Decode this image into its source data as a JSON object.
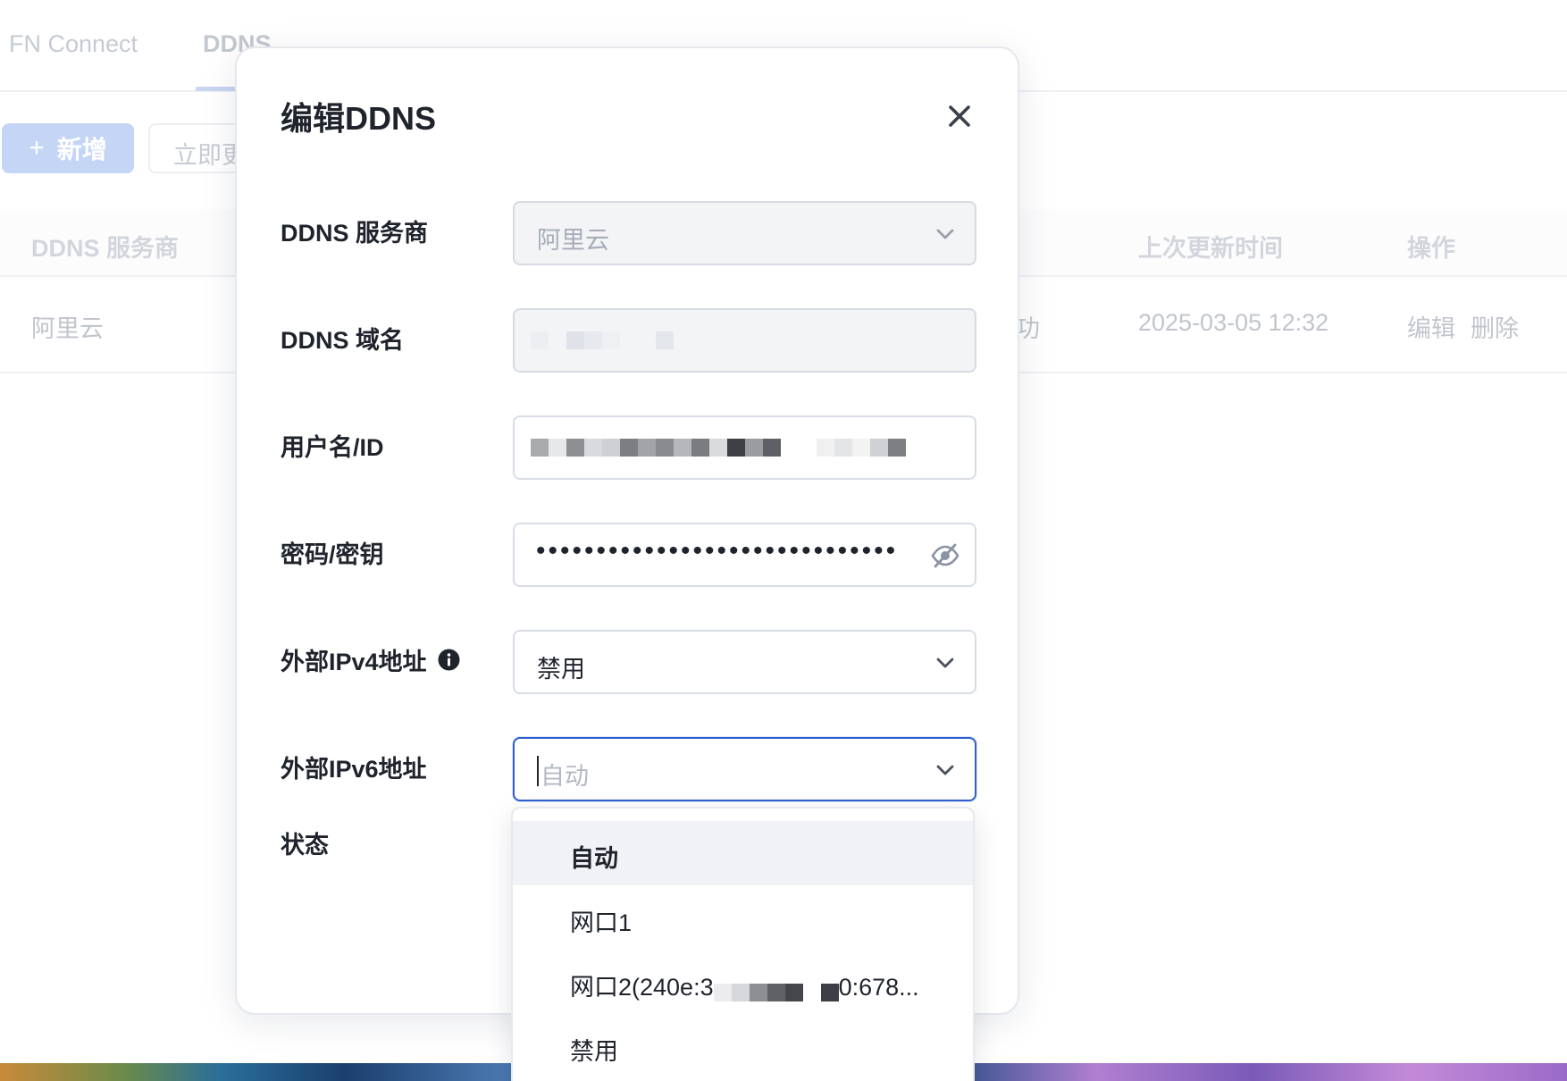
{
  "background": {
    "tabs": [
      {
        "label": "FN Connect"
      },
      {
        "label": "DDNS"
      }
    ],
    "toolbar": {
      "add_icon": "plus-icon",
      "add_label": "新增",
      "update_label": "立即更"
    },
    "table": {
      "headers": [
        "DDNS 服务商",
        "上次更新时间",
        "操作"
      ],
      "row": {
        "provider": "阿里云",
        "status_fragment": "功",
        "updated": "2025-03-05 12:32",
        "edit": "编辑",
        "delete": "删除"
      }
    }
  },
  "modal": {
    "title": "编辑DDNS",
    "close_icon": "close-icon",
    "fields": {
      "provider": {
        "label": "DDNS 服务商",
        "value": "阿里云",
        "disabled": true
      },
      "domain": {
        "label": "DDNS 域名",
        "disabled": true
      },
      "username": {
        "label": "用户名/ID"
      },
      "password": {
        "label": "密码/密钥",
        "value": "••••••••••••••••••••••••••••••",
        "toggle_icon": "eye-off-icon"
      },
      "ipv4": {
        "label": "外部IPv4地址",
        "info_icon": "info-icon",
        "value": "禁用"
      },
      "ipv6": {
        "label": "外部IPv6地址",
        "placeholder": "自动",
        "focused": true
      },
      "status": {
        "label": "状态"
      }
    }
  },
  "dropdown": {
    "options": [
      {
        "label": "自动",
        "selected": true
      },
      {
        "label": "网口1"
      },
      {
        "label_prefix": "网口2(240e:3",
        "label_suffix": "0:678..."
      },
      {
        "label": "禁用"
      }
    ]
  },
  "colors": {
    "accent": "#2f5fd0",
    "primary_button_disabled": "#c4d5f6",
    "text": "#1f232b"
  }
}
